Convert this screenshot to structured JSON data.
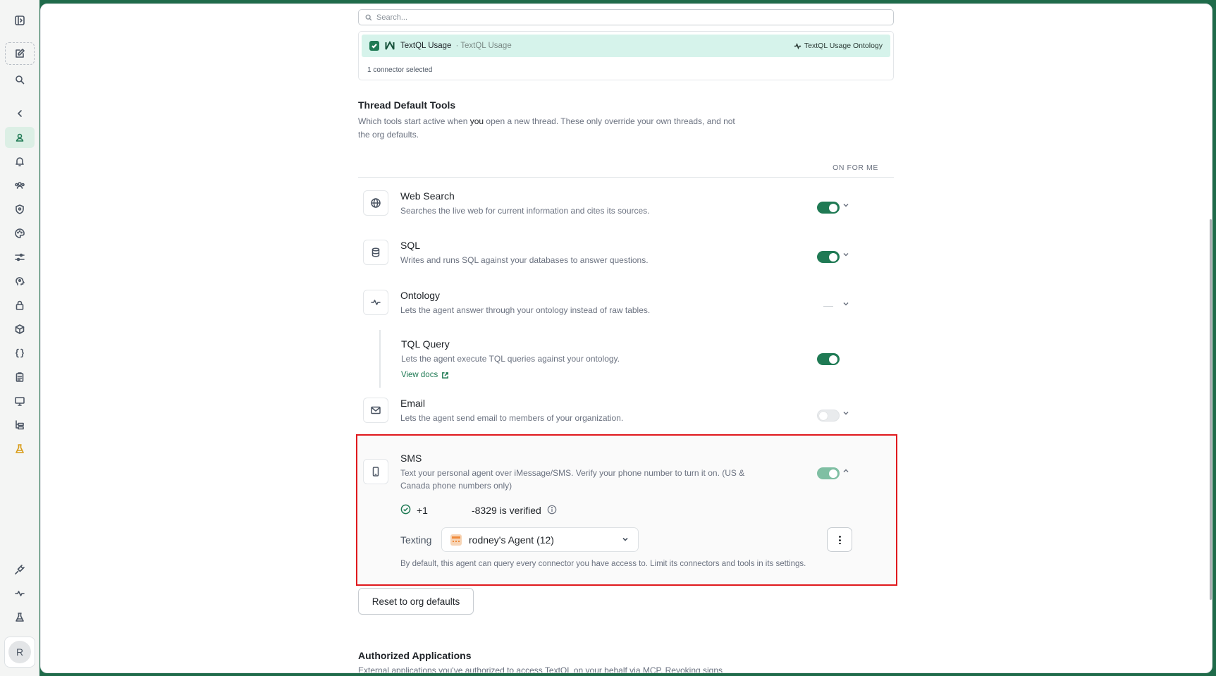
{
  "search": {
    "placeholder": "Search..."
  },
  "connector": {
    "name": "TextQL Usage",
    "subtitle": "· TextQL Usage",
    "ontology": "TextQL Usage Ontology",
    "selected_count": "1 connector selected"
  },
  "thread_tools": {
    "title": "Thread Default Tools",
    "desc_before": "Which tools start active when ",
    "desc_emph": "you",
    "desc_after": " open a new thread. These only override your own threads, and not the org defaults.",
    "column_header": "ON FOR ME",
    "tools": [
      {
        "name": "Web Search",
        "desc": "Searches the live web for current information and cites its sources.",
        "icon": "globe-icon",
        "state": "on"
      },
      {
        "name": "SQL",
        "desc": "Writes and runs SQL against your databases to answer questions.",
        "icon": "database-icon",
        "state": "on"
      },
      {
        "name": "Ontology",
        "desc": "Lets the agent answer through your ontology instead of raw tables.",
        "icon": "ontology-icon",
        "state": "mixed"
      },
      {
        "name": "TQL Query",
        "desc": "Lets the agent execute TQL queries against your ontology.",
        "link": "View docs",
        "state": "on"
      },
      {
        "name": "Email",
        "desc": "Lets the agent send email to members of your organization.",
        "icon": "mail-icon",
        "state": "off"
      },
      {
        "name": "SMS",
        "desc": "Text your personal agent over iMessage/SMS. Verify your phone number to turn it on. (US & Canada phone numbers only)",
        "icon": "phone-icon",
        "state": "on"
      }
    ]
  },
  "sms": {
    "phone_prefix": "+1",
    "phone_suffix": "-8329 is verified",
    "texting_label": "Texting",
    "agent_name": "rodney's Agent (12)",
    "note": "By default, this agent can query every connector you have access to. Limit its connectors and tools in its settings."
  },
  "reset_label": "Reset to org defaults",
  "authorized": {
    "title": "Authorized Applications",
    "desc": "External applications you've authorized to access TextQL on your behalf via MCP. Revoking signs"
  },
  "user": {
    "avatar_initial": "R"
  },
  "colors": {
    "accent": "#1f7a54",
    "highlight": "#d6f3eb",
    "annotation": "#e0191d",
    "warn": "#d89b16"
  }
}
